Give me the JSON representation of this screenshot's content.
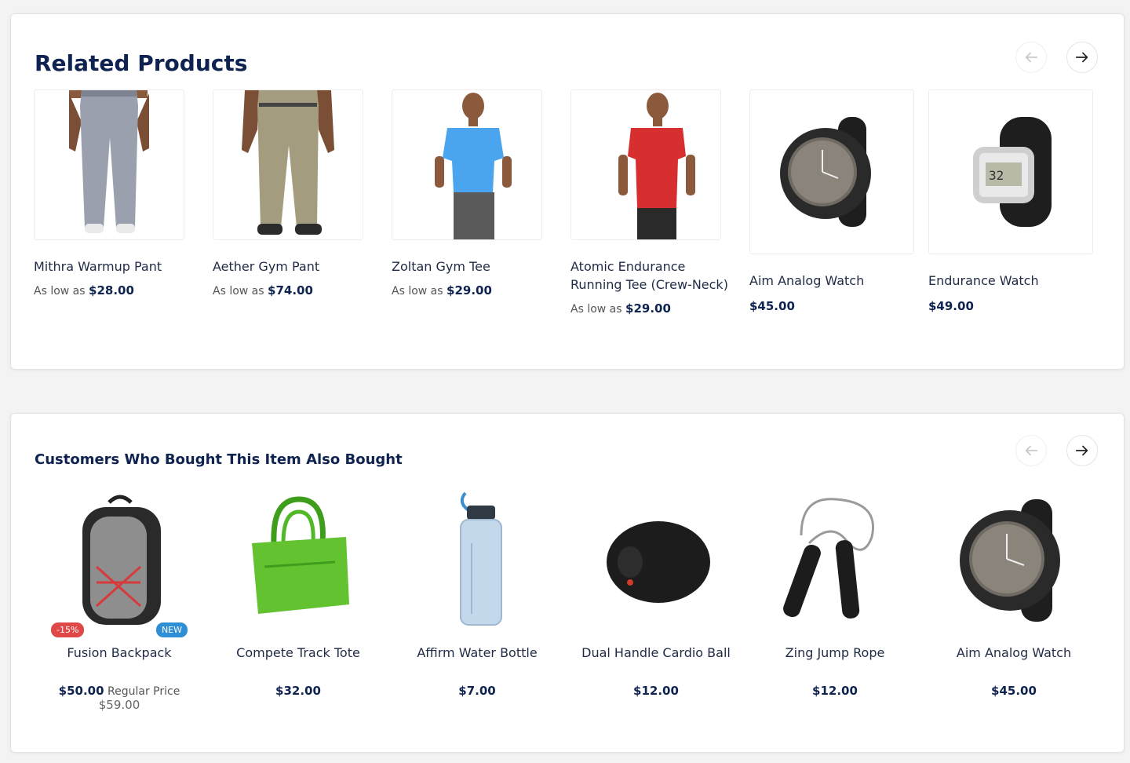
{
  "related": {
    "title": "Related Products",
    "prev_label": "previous",
    "next_label": "next",
    "as_low_as": "As low as",
    "items": [
      {
        "name": "Mithra Warmup Pant",
        "price": "$28.00",
        "image": "gray-pants"
      },
      {
        "name": "Aether Gym Pant",
        "price": "$74.00",
        "image": "khaki-pants"
      },
      {
        "name": "Zoltan Gym Tee",
        "price": "$29.00",
        "image": "blue-tee"
      },
      {
        "name": "Atomic Endurance Running Tee (Crew-Neck)",
        "price": "$29.00",
        "image": "red-tee"
      },
      {
        "name": "Aim Analog Watch",
        "price": "$45.00",
        "image": "analog-watch"
      },
      {
        "name": "Endurance Watch",
        "price": "$49.00",
        "image": "digital-watch"
      }
    ]
  },
  "bought": {
    "title": "Customers Who Bought This Item Also Bought",
    "items": [
      {
        "name": "Fusion Backpack",
        "price": "$50.00",
        "regular_label": "Regular Price",
        "regular_price": "$59.00",
        "badge_sale": "-15%",
        "badge_new": "NEW",
        "image": "backpack"
      },
      {
        "name": "Compete Track Tote",
        "price": "$32.00",
        "image": "green-tote"
      },
      {
        "name": "Affirm Water Bottle",
        "price": "$7.00",
        "image": "water-bottle"
      },
      {
        "name": "Dual Handle Cardio Ball",
        "price": "$12.00",
        "image": "cardio-ball"
      },
      {
        "name": "Zing Jump Rope",
        "price": "$12.00",
        "image": "jump-rope"
      },
      {
        "name": "Aim Analog Watch",
        "price": "$45.00",
        "image": "analog-watch"
      }
    ]
  },
  "colors": {
    "heading": "#0f2350",
    "sale_badge": "#e04747",
    "new_badge": "#2f8fd6"
  }
}
